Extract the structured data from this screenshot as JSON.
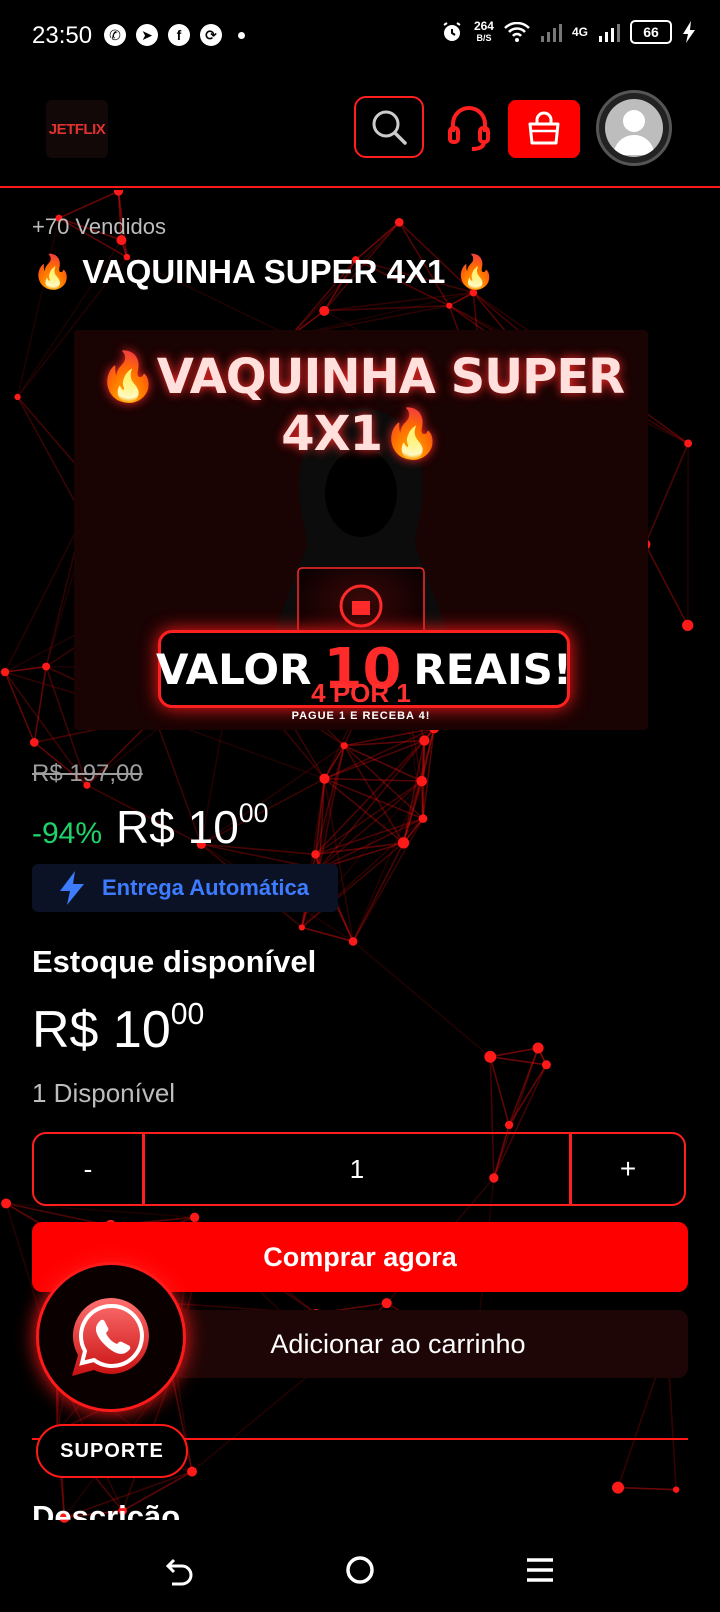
{
  "status_bar": {
    "time": "23:50",
    "net_speed": "264",
    "net_unit": "B/S",
    "network_type": "4G",
    "battery": "66",
    "app_icons": [
      "whatsapp-icon",
      "telegram-icon",
      "facebook-icon",
      "sync-icon"
    ]
  },
  "header": {
    "logo": "JETFLIX"
  },
  "product": {
    "sold": "+70 Vendidos",
    "title": "🔥 VAQUINHA SUPER 4X1 🔥",
    "banner": {
      "title": "🔥VAQUINHA SUPER 4X1🔥",
      "valor_left": "VALOR",
      "valor_num": "10",
      "valor_right": "REAIS!",
      "offer": "4 POR 1",
      "offer_sub": "PAGUE 1 E RECEBA 4!"
    },
    "old_price": "R$ 197,00",
    "discount": "-94%",
    "price_int": "R$ 10",
    "price_cents": "00",
    "delivery": "Entrega Automática"
  },
  "stock": {
    "title": "Estoque disponível",
    "price_int": "R$ 10",
    "price_cents": "00",
    "available": "1 Disponível"
  },
  "quantity": {
    "minus": "-",
    "value": "1",
    "plus": "+"
  },
  "actions": {
    "buy": "Comprar agora",
    "add_to_cart": "Adicionar ao carrinho",
    "support": "SUPORTE"
  },
  "description_heading": "Descrição",
  "colors": {
    "accent": "#ff0000",
    "discount": "#1fd36b",
    "delivery_text": "#3d7bff"
  }
}
